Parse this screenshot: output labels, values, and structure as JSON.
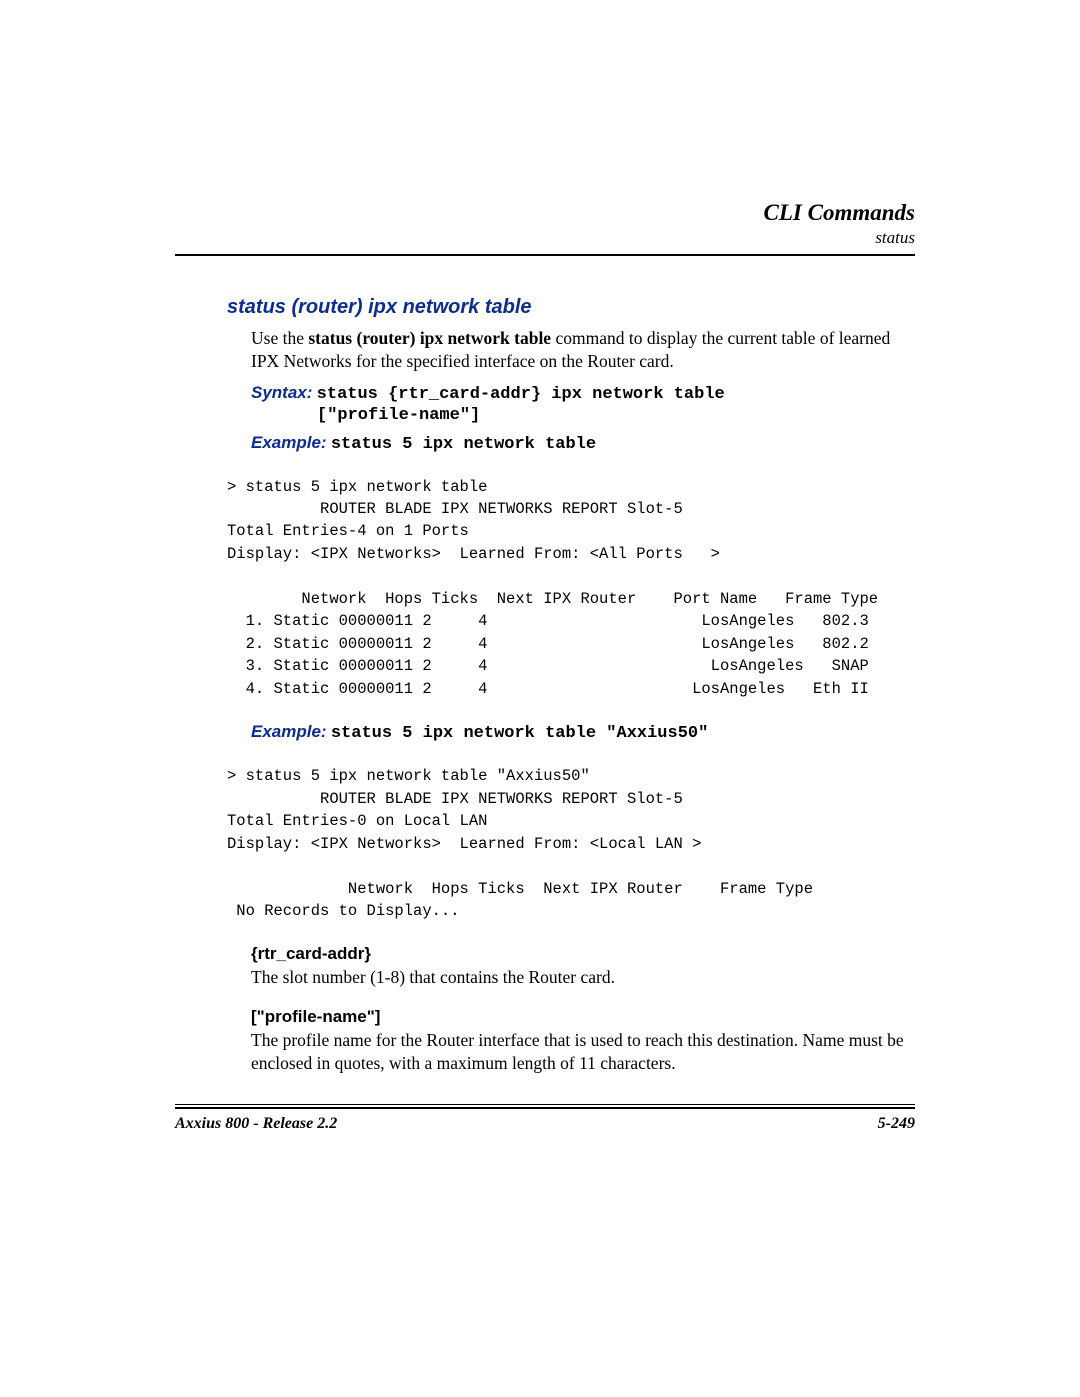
{
  "header": {
    "title": "CLI Commands",
    "subtitle": "status"
  },
  "section": {
    "title": "status (router) ipx network table",
    "intro_pre": "Use the ",
    "intro_bold": "status (router) ipx network table",
    "intro_post": " command to display the current table of learned IPX Networks for the specified interface on the Router card.",
    "syntax_label": "Syntax:",
    "syntax_line1": "status {rtr_card-addr} ipx network table",
    "syntax_line2": "[\"profile-name\"]",
    "example1_label": "Example:",
    "example1_cmd": "status 5 ipx network table",
    "output1": "> status 5 ipx network table\n          ROUTER BLADE IPX NETWORKS REPORT Slot-5\nTotal Entries-4 on 1 Ports\nDisplay: <IPX Networks>  Learned From: <All Ports   >\n\n        Network  Hops Ticks  Next IPX Router    Port Name   Frame Type\n  1. Static 00000011 2     4                       LosAngeles   802.3\n  2. Static 00000011 2     4                       LosAngeles   802.2\n  3. Static 00000011 2     4                        LosAngeles   SNAP\n  4. Static 00000011 2     4                      LosAngeles   Eth II",
    "example2_label": "Example:",
    "example2_cmd": "status 5 ipx network table \"Axxius50\"",
    "output2": "> status 5 ipx network table \"Axxius50\"\n          ROUTER BLADE IPX NETWORKS REPORT Slot-5\nTotal Entries-0 on Local LAN\nDisplay: <IPX Networks>  Learned From: <Local LAN >\n\n             Network  Hops Ticks  Next IPX Router    Frame Type\n No Records to Display...",
    "param1_heading": "{rtr_card-addr}",
    "param1_text": "The slot number (1-8) that contains the Router card.",
    "param2_heading": "[\"profile-name\"]",
    "param2_text": "The profile name for the Router interface that is used to reach this destination. Name must be enclosed in quotes, with a maximum length of 11 characters."
  },
  "footer": {
    "left": "Axxius 800 - Release 2.2",
    "right": "5-249"
  }
}
